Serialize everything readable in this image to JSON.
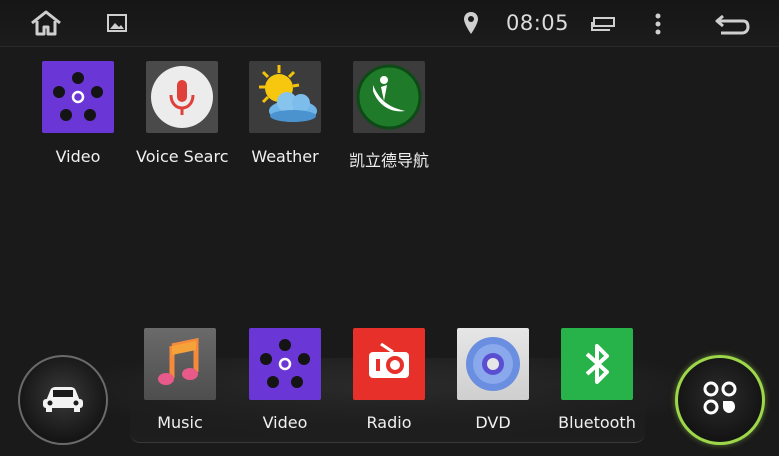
{
  "status_bar": {
    "home_icon": "home-icon",
    "gallery_icon": "image-icon",
    "location_icon": "location-pin-icon",
    "time": "08:05",
    "recents_icon": "recent-apps-icon",
    "menu_icon": "overflow-menu-icon",
    "back_icon": "back-icon"
  },
  "desktop": {
    "apps": [
      {
        "label": "Video",
        "icon": "video-app-icon"
      },
      {
        "label": "Voice Searc",
        "icon": "microphone-icon"
      },
      {
        "label": "Weather",
        "icon": "weather-sun-cloud-icon"
      },
      {
        "label": "凯立德导航",
        "icon": "navigation-app-icon"
      }
    ]
  },
  "dock": {
    "left_button_icon": "car-icon",
    "right_button_icon": "app-drawer-icon",
    "apps": [
      {
        "label": "Music",
        "icon": "music-note-icon"
      },
      {
        "label": "Video",
        "icon": "video-app-icon"
      },
      {
        "label": "Radio",
        "icon": "radio-icon"
      },
      {
        "label": "DVD",
        "icon": "disc-icon"
      },
      {
        "label": "Bluetooth",
        "icon": "bluetooth-icon"
      }
    ]
  },
  "colors": {
    "background": "#1a1a1a",
    "video_purple": "#6a36d6",
    "radio_red": "#e8302a",
    "bluetooth_green": "#27b24a",
    "drawer_ring": "#9ed84a"
  }
}
